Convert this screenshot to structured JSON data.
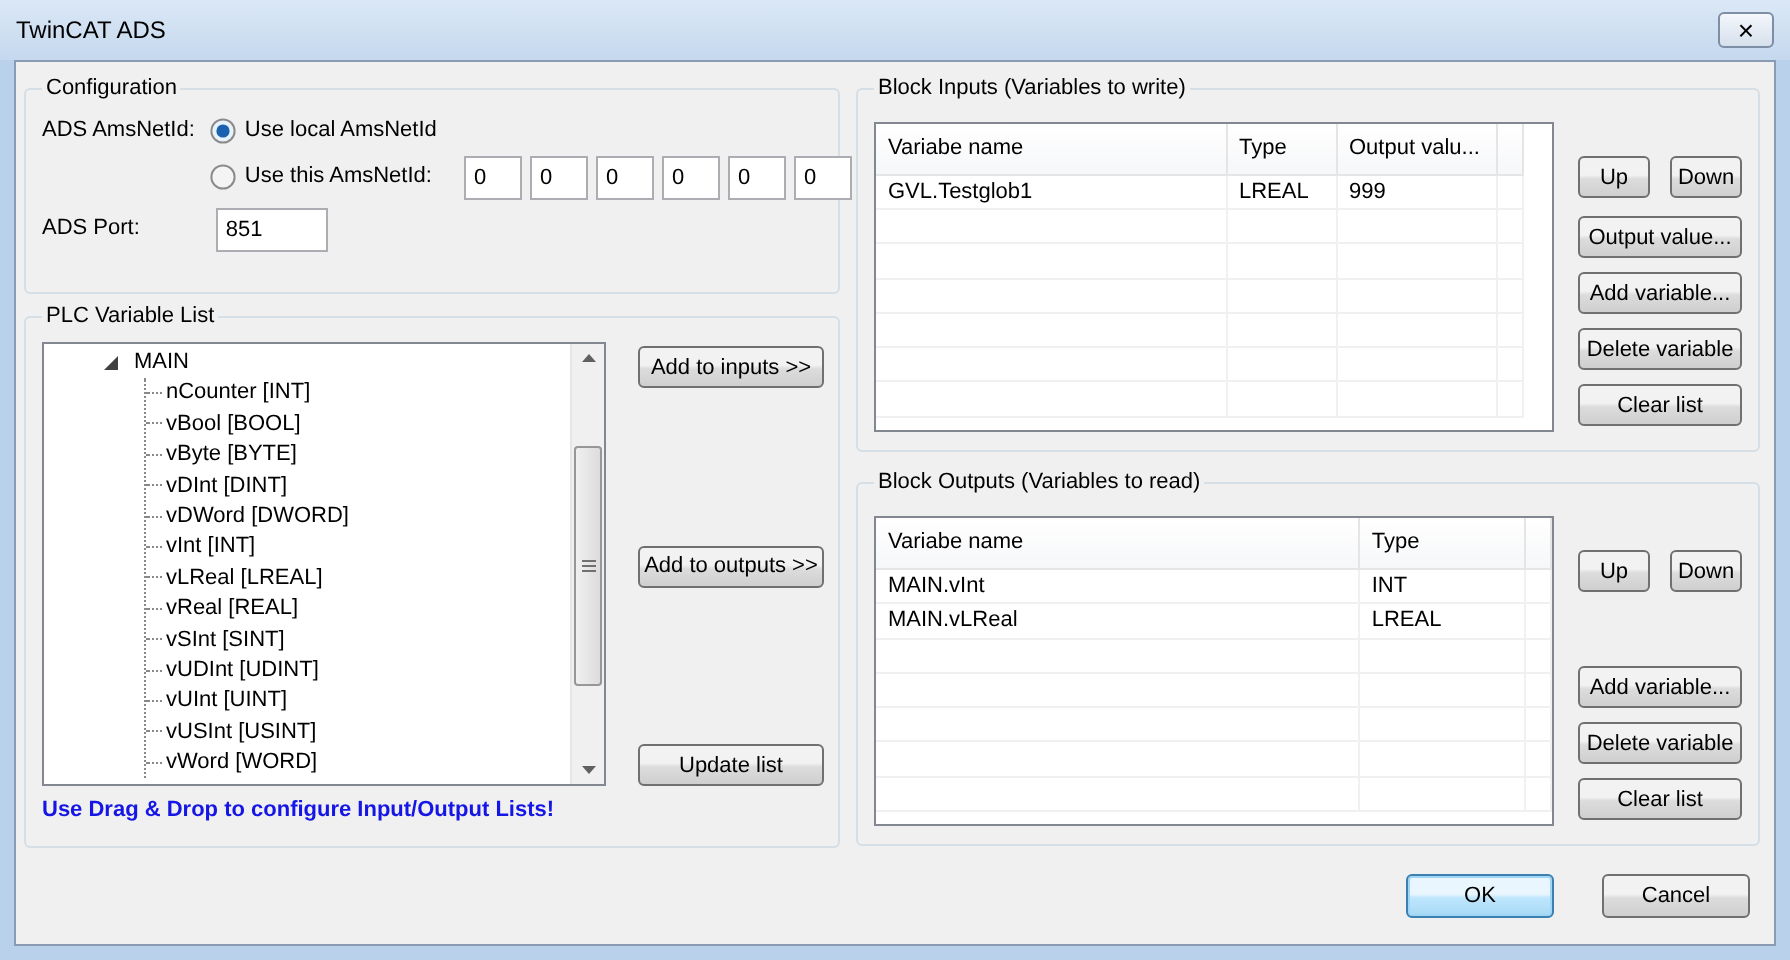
{
  "window": {
    "title": "TwinCAT ADS",
    "close_label": "×"
  },
  "configuration": {
    "title": "Configuration",
    "amsnetid_label": "ADS AmsNetId:",
    "options": [
      {
        "label": "Use local AmsNetId",
        "selected": true
      },
      {
        "label": "Use this AmsNetId:",
        "selected": false
      }
    ],
    "netid_fields": [
      "0",
      "0",
      "0",
      "0",
      "0",
      "0"
    ],
    "port_label": "ADS Port:",
    "port_value": "851"
  },
  "plc_list": {
    "title": "PLC Variable List",
    "tree": [
      {
        "label": "MAIN",
        "expanded": true,
        "children": [
          {
            "label": "nCounter [INT]"
          },
          {
            "label": "vBool [BOOL]"
          },
          {
            "label": "vByte [BYTE]"
          },
          {
            "label": "vDInt [DINT]"
          },
          {
            "label": "vDWord [DWORD]"
          },
          {
            "label": "vInt [INT]"
          },
          {
            "label": "vLReal [LREAL]"
          },
          {
            "label": "vReal [REAL]"
          },
          {
            "label": "vSInt [SINT]"
          },
          {
            "label": "vUDInt [UDINT]"
          },
          {
            "label": "vUInt [UINT]"
          },
          {
            "label": "vUSInt [USINT]"
          },
          {
            "label": "vWord [WORD]"
          }
        ]
      }
    ],
    "buttons": [
      "Add to inputs >>",
      "Add to outputs >>",
      "Update list"
    ],
    "hint": "Use Drag & Drop to configure Input/Output Lists!"
  },
  "block_inputs": {
    "title": "Block Inputs (Variables to write)",
    "columns": [
      "Variabe name",
      "Type",
      "Output valu..."
    ],
    "rows": [
      [
        "GVL.Testglob1",
        "LREAL",
        "999"
      ]
    ],
    "buttons": [
      "Up",
      "Down",
      "Output value...",
      "Add variable...",
      "Delete variable",
      "Clear list"
    ]
  },
  "block_outputs": {
    "title": "Block Outputs (Variables to read)",
    "columns": [
      "Variabe name",
      "Type"
    ],
    "rows": [
      [
        "MAIN.vInt",
        "INT"
      ],
      [
        "MAIN.vLReal",
        "LREAL"
      ]
    ],
    "buttons": [
      "Up",
      "Down",
      "Add variable...",
      "Delete variable",
      "Clear list"
    ]
  },
  "footer_buttons": [
    {
      "label": "OK",
      "default": true
    },
    {
      "label": "Cancel",
      "default": false
    }
  ]
}
